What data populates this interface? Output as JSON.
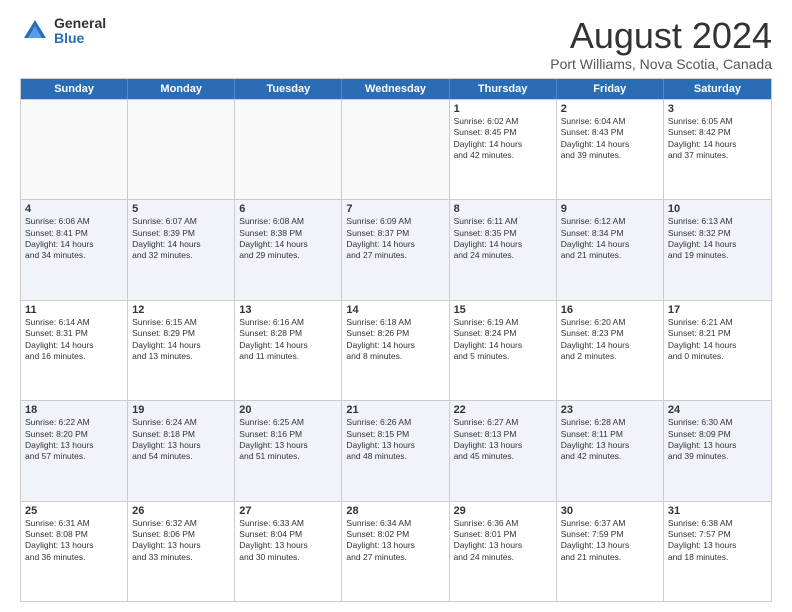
{
  "logo": {
    "general": "General",
    "blue": "Blue"
  },
  "title": "August 2024",
  "location": "Port Williams, Nova Scotia, Canada",
  "days_of_week": [
    "Sunday",
    "Monday",
    "Tuesday",
    "Wednesday",
    "Thursday",
    "Friday",
    "Saturday"
  ],
  "weeks": [
    [
      {
        "day": "",
        "empty": true,
        "text": ""
      },
      {
        "day": "",
        "empty": true,
        "text": ""
      },
      {
        "day": "",
        "empty": true,
        "text": ""
      },
      {
        "day": "",
        "empty": true,
        "text": ""
      },
      {
        "day": "1",
        "text": "Sunrise: 6:02 AM\nSunset: 8:45 PM\nDaylight: 14 hours\nand 42 minutes."
      },
      {
        "day": "2",
        "text": "Sunrise: 6:04 AM\nSunset: 8:43 PM\nDaylight: 14 hours\nand 39 minutes."
      },
      {
        "day": "3",
        "text": "Sunrise: 6:05 AM\nSunset: 8:42 PM\nDaylight: 14 hours\nand 37 minutes."
      }
    ],
    [
      {
        "day": "4",
        "text": "Sunrise: 6:06 AM\nSunset: 8:41 PM\nDaylight: 14 hours\nand 34 minutes."
      },
      {
        "day": "5",
        "text": "Sunrise: 6:07 AM\nSunset: 8:39 PM\nDaylight: 14 hours\nand 32 minutes."
      },
      {
        "day": "6",
        "text": "Sunrise: 6:08 AM\nSunset: 8:38 PM\nDaylight: 14 hours\nand 29 minutes."
      },
      {
        "day": "7",
        "text": "Sunrise: 6:09 AM\nSunset: 8:37 PM\nDaylight: 14 hours\nand 27 minutes."
      },
      {
        "day": "8",
        "text": "Sunrise: 6:11 AM\nSunset: 8:35 PM\nDaylight: 14 hours\nand 24 minutes."
      },
      {
        "day": "9",
        "text": "Sunrise: 6:12 AM\nSunset: 8:34 PM\nDaylight: 14 hours\nand 21 minutes."
      },
      {
        "day": "10",
        "text": "Sunrise: 6:13 AM\nSunset: 8:32 PM\nDaylight: 14 hours\nand 19 minutes."
      }
    ],
    [
      {
        "day": "11",
        "text": "Sunrise: 6:14 AM\nSunset: 8:31 PM\nDaylight: 14 hours\nand 16 minutes."
      },
      {
        "day": "12",
        "text": "Sunrise: 6:15 AM\nSunset: 8:29 PM\nDaylight: 14 hours\nand 13 minutes."
      },
      {
        "day": "13",
        "text": "Sunrise: 6:16 AM\nSunset: 8:28 PM\nDaylight: 14 hours\nand 11 minutes."
      },
      {
        "day": "14",
        "text": "Sunrise: 6:18 AM\nSunset: 8:26 PM\nDaylight: 14 hours\nand 8 minutes."
      },
      {
        "day": "15",
        "text": "Sunrise: 6:19 AM\nSunset: 8:24 PM\nDaylight: 14 hours\nand 5 minutes."
      },
      {
        "day": "16",
        "text": "Sunrise: 6:20 AM\nSunset: 8:23 PM\nDaylight: 14 hours\nand 2 minutes."
      },
      {
        "day": "17",
        "text": "Sunrise: 6:21 AM\nSunset: 8:21 PM\nDaylight: 14 hours\nand 0 minutes."
      }
    ],
    [
      {
        "day": "18",
        "text": "Sunrise: 6:22 AM\nSunset: 8:20 PM\nDaylight: 13 hours\nand 57 minutes."
      },
      {
        "day": "19",
        "text": "Sunrise: 6:24 AM\nSunset: 8:18 PM\nDaylight: 13 hours\nand 54 minutes."
      },
      {
        "day": "20",
        "text": "Sunrise: 6:25 AM\nSunset: 8:16 PM\nDaylight: 13 hours\nand 51 minutes."
      },
      {
        "day": "21",
        "text": "Sunrise: 6:26 AM\nSunset: 8:15 PM\nDaylight: 13 hours\nand 48 minutes."
      },
      {
        "day": "22",
        "text": "Sunrise: 6:27 AM\nSunset: 8:13 PM\nDaylight: 13 hours\nand 45 minutes."
      },
      {
        "day": "23",
        "text": "Sunrise: 6:28 AM\nSunset: 8:11 PM\nDaylight: 13 hours\nand 42 minutes."
      },
      {
        "day": "24",
        "text": "Sunrise: 6:30 AM\nSunset: 8:09 PM\nDaylight: 13 hours\nand 39 minutes."
      }
    ],
    [
      {
        "day": "25",
        "text": "Sunrise: 6:31 AM\nSunset: 8:08 PM\nDaylight: 13 hours\nand 36 minutes."
      },
      {
        "day": "26",
        "text": "Sunrise: 6:32 AM\nSunset: 8:06 PM\nDaylight: 13 hours\nand 33 minutes."
      },
      {
        "day": "27",
        "text": "Sunrise: 6:33 AM\nSunset: 8:04 PM\nDaylight: 13 hours\nand 30 minutes."
      },
      {
        "day": "28",
        "text": "Sunrise: 6:34 AM\nSunset: 8:02 PM\nDaylight: 13 hours\nand 27 minutes."
      },
      {
        "day": "29",
        "text": "Sunrise: 6:36 AM\nSunset: 8:01 PM\nDaylight: 13 hours\nand 24 minutes."
      },
      {
        "day": "30",
        "text": "Sunrise: 6:37 AM\nSunset: 7:59 PM\nDaylight: 13 hours\nand 21 minutes."
      },
      {
        "day": "31",
        "text": "Sunrise: 6:38 AM\nSunset: 7:57 PM\nDaylight: 13 hours\nand 18 minutes."
      }
    ]
  ]
}
